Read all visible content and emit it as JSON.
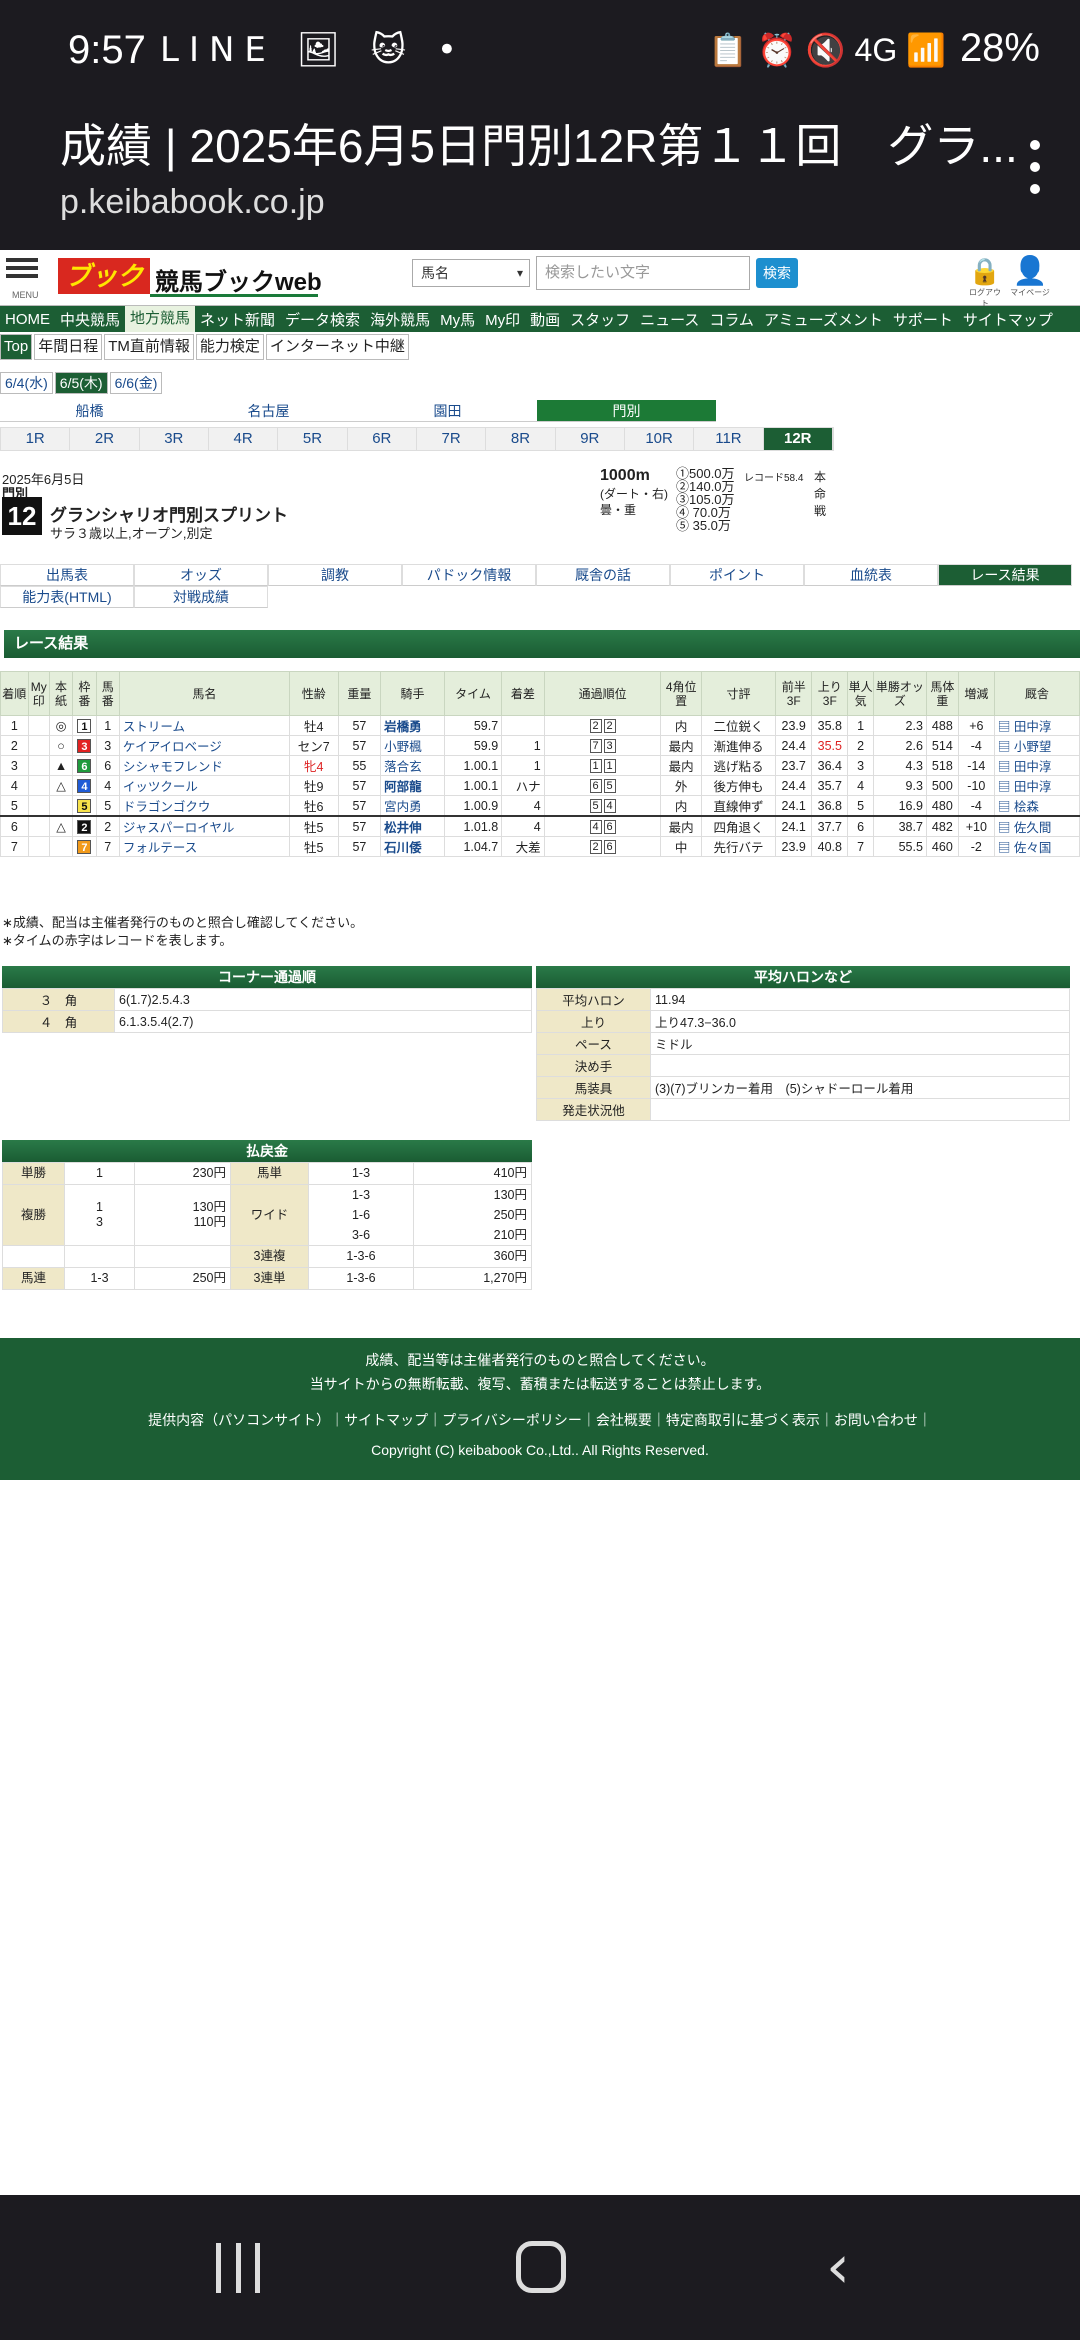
{
  "status_bar": {
    "time": "9:57",
    "notif_icons": "LINE 🖼 🐱 •",
    "right_icons": "📋 ⏰ 🔇 4G 📶",
    "battery": "28%"
  },
  "browser": {
    "title": "成績 | 2025年6月5日門別12R第１１回　グラ...",
    "host": "p.keibabook.co.jp"
  },
  "header": {
    "menu_label": "MENU",
    "logo": "ブック",
    "site_name": "競馬ブックweb",
    "select_value": "馬名",
    "search_placeholder": "検索したい文字",
    "search_btn": "検索",
    "logout": "ログアウト",
    "mypage": "マイページ"
  },
  "global_nav": [
    "HOME",
    "中央競馬",
    "地方競馬",
    "ネット新聞",
    "データ検索",
    "海外競馬",
    "My馬",
    "My印",
    "動画",
    "スタッフ",
    "ニュース",
    "コラム",
    "アミューズメント",
    "サポート",
    "サイトマップ"
  ],
  "global_nav_active": 2,
  "sub_nav": [
    "Top",
    "年間日程",
    "TM直前情報",
    "能力検定",
    "インターネット中継"
  ],
  "dates": [
    "6/4(水)",
    "6/5(木)",
    "6/6(金)"
  ],
  "venues": [
    "船橋",
    "名古屋",
    "園田",
    "門別"
  ],
  "races": [
    "1R",
    "2R",
    "3R",
    "4R",
    "5R",
    "6R",
    "7R",
    "8R",
    "9R",
    "10R",
    "11R",
    "12R"
  ],
  "race": {
    "date": "2025年6月5日",
    "venue": "門別",
    "num": "12",
    "name": "グランシャリオ門別スプリント",
    "conditions": "サラ３歳以上,オープン,別定",
    "distance": "1000m",
    "course": "(ダート・右)",
    "ground": "曇・重",
    "prizes": [
      "①500.0万",
      "②140.0万",
      "③105.0万",
      "④ 70.0万",
      "⑤ 35.0万"
    ],
    "record": "レコード58.4",
    "side": "本命戦"
  },
  "tabs_row1": [
    "出馬表",
    "オッズ",
    "調教",
    "パドック情報",
    "厩舎の話",
    "ポイント",
    "血統表",
    "レース結果"
  ],
  "tabs_row2": [
    "能力表(HTML)",
    "対戦成績"
  ],
  "section_title": "レース結果",
  "results_headers": [
    "着順",
    "My印",
    "本紙",
    "枠番",
    "馬番",
    "馬名",
    "性齢",
    "重量",
    "騎手",
    "タイム",
    "着差",
    "通過順位",
    "4角位置",
    "寸評",
    "前半3F",
    "上り3F",
    "単人気",
    "単勝オッズ",
    "馬体重",
    "増減",
    "厩舎"
  ],
  "results": [
    {
      "pos": "1",
      "my": "",
      "mark": "◎",
      "waku": "1",
      "uma": "1",
      "name": "ストリーム",
      "sex": "牡4",
      "wt": "57",
      "jockey": "岩橋勇",
      "time": "59.7",
      "diff": "",
      "pass": [
        "2",
        "2"
      ],
      "pos4": "内",
      "comment": "二位鋭く",
      "f3": "23.9",
      "l3": "35.8",
      "pop": "1",
      "odds": "2.3",
      "bw": "488",
      "chg": "+6",
      "trainer": "田中淳"
    },
    {
      "pos": "2",
      "my": "",
      "mark": "○",
      "waku": "3",
      "uma": "3",
      "name": "ケイアイロベージ",
      "sex": "セン7",
      "wt": "57",
      "jockey": "小野楓",
      "time": "59.9",
      "diff": "1",
      "pass": [
        "7",
        "3"
      ],
      "pos4": "最内",
      "comment": "漸進伸る",
      "f3": "24.4",
      "l3": "35.5",
      "pop": "2",
      "odds": "2.6",
      "bw": "514",
      "chg": "-4",
      "trainer": "小野望"
    },
    {
      "pos": "3",
      "my": "",
      "mark": "▲",
      "waku": "6",
      "uma": "6",
      "name": "シシャモフレンド",
      "sex": "牝4",
      "wt": "55",
      "jockey": "落合玄",
      "time": "1.00.1",
      "diff": "1",
      "pass": [
        "1",
        "1"
      ],
      "pos4": "最内",
      "comment": "逃げ粘る",
      "f3": "23.7",
      "l3": "36.4",
      "pop": "3",
      "odds": "4.3",
      "bw": "518",
      "chg": "-14",
      "trainer": "田中淳"
    },
    {
      "pos": "4",
      "my": "",
      "mark": "△",
      "waku": "4",
      "uma": "4",
      "name": "イッツクール",
      "sex": "牡9",
      "wt": "57",
      "jockey": "阿部龍",
      "time": "1.00.1",
      "diff": "ハナ",
      "pass": [
        "6",
        "5"
      ],
      "pos4": "外",
      "comment": "後方伸も",
      "f3": "24.4",
      "l3": "35.7",
      "pop": "4",
      "odds": "9.3",
      "bw": "500",
      "chg": "-10",
      "trainer": "田中淳"
    },
    {
      "pos": "5",
      "my": "",
      "mark": "",
      "waku": "5",
      "uma": "5",
      "name": "ドラゴンゴクウ",
      "sex": "牡6",
      "wt": "57",
      "jockey": "宮内勇",
      "time": "1.00.9",
      "diff": "4",
      "pass": [
        "5",
        "4"
      ],
      "pos4": "内",
      "comment": "直線伸ず",
      "f3": "24.1",
      "l3": "36.8",
      "pop": "5",
      "odds": "16.9",
      "bw": "480",
      "chg": "-4",
      "trainer": "桧森"
    },
    {
      "pos": "6",
      "my": "",
      "mark": "△",
      "waku": "2",
      "uma": "2",
      "name": "ジャスパーロイヤル",
      "sex": "牡5",
      "wt": "57",
      "jockey": "松井伸",
      "time": "1.01.8",
      "diff": "4",
      "pass": [
        "4",
        "6"
      ],
      "pos4": "最内",
      "comment": "四角退く",
      "f3": "24.1",
      "l3": "37.7",
      "pop": "6",
      "odds": "38.7",
      "bw": "482",
      "chg": "+10",
      "trainer": "佐久間"
    },
    {
      "pos": "7",
      "my": "",
      "mark": "",
      "waku": "7",
      "uma": "7",
      "name": "フォルテース",
      "sex": "牡5",
      "wt": "57",
      "jockey": "石川倭",
      "time": "1.04.7",
      "diff": "大差",
      "pass": [
        "2",
        "6"
      ],
      "pos4": "中",
      "comment": "先行バテ",
      "f3": "23.9",
      "l3": "40.8",
      "pop": "7",
      "odds": "55.5",
      "bw": "460",
      "chg": "-2",
      "trainer": "佐々国"
    }
  ],
  "waku_colors": {
    "1": "#ffffff",
    "2": "#111111",
    "3": "#e22222",
    "4": "#1f5bd6",
    "5": "#f7e24a",
    "6": "#1f9a3c",
    "7": "#f29a1a"
  },
  "notes": [
    "∗成績、配当は主催者発行のものと照合し確認してください。",
    "∗タイムの赤字はレコードを表します。"
  ],
  "corner": {
    "title": "コーナー通過順",
    "rows": [
      {
        "k": "３　角",
        "v": "6(1.7)2.5.4.3"
      },
      {
        "k": "４　角",
        "v": "6.1.3.5.4(2.7)"
      }
    ]
  },
  "halon": {
    "title": "平均ハロンなど",
    "rows": [
      {
        "k": "平均ハロン",
        "v": "11.94"
      },
      {
        "k": "上り",
        "v": "上り47.3−36.0"
      },
      {
        "k": "ペース",
        "v": "ミドル"
      },
      {
        "k": "決め手",
        "v": ""
      },
      {
        "k": "馬装具",
        "v": "(3)(7)ブリンカー着用　(5)シャドーロール着用"
      },
      {
        "k": "発走状況他",
        "v": ""
      }
    ]
  },
  "payout": {
    "title": "払戻金",
    "tansho": {
      "k": "単勝",
      "n": "1",
      "p": "230円"
    },
    "umatan": {
      "k": "馬単",
      "n": "1-3",
      "p": "410円"
    },
    "fukusho": {
      "k": "複勝",
      "n1": "1",
      "p1": "130円",
      "n2": "3",
      "p2": "110円"
    },
    "wide": {
      "k": "ワイド",
      "n1": "1-3",
      "p1": "130円",
      "n2": "1-6",
      "p2": "250円",
      "n3": "3-6",
      "p3": "210円"
    },
    "sanrenpuku": {
      "k": "3連複",
      "n": "1-3-6",
      "p": "360円"
    },
    "umaren": {
      "k": "馬連",
      "n": "1-3",
      "p": "250円"
    },
    "sanrentan": {
      "k": "3連単",
      "n": "1-3-6",
      "p": "1,270円"
    }
  },
  "footer": {
    "line1": "成績、配当等は主催者発行のものと照合してください。",
    "line2": "当サイトからの無断転載、複写、蓄積または転送することは禁止します。",
    "links": "提供内容（パソコンサイト）｜サイトマップ｜プライバシーポリシー｜会社概要｜特定商取引に基づく表示｜お問い合わせ｜",
    "copyright": "Copyright (C) keibabook Co.,Ltd.. All Rights Reserved."
  }
}
